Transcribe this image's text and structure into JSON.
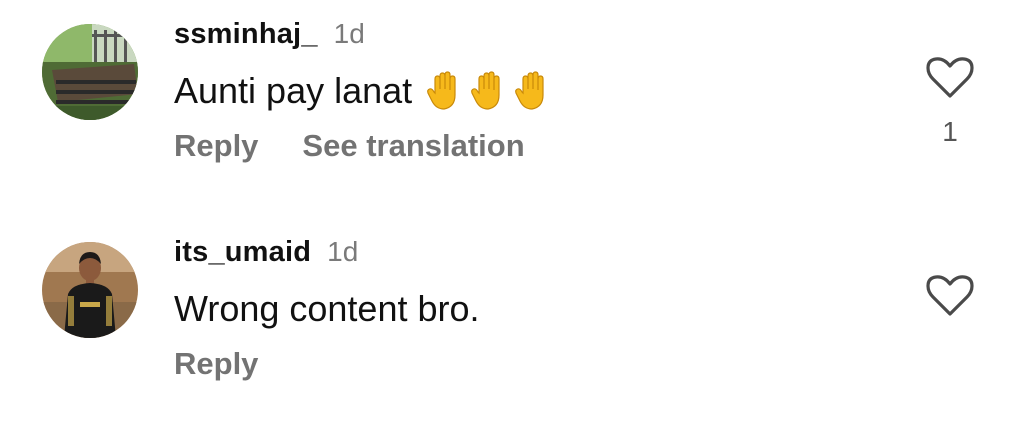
{
  "comments": [
    {
      "username": "ssminhaj_",
      "timestamp": "1d",
      "text": "Aunti pay lanat",
      "emojis": [
        "raised-hand-emoji",
        "raised-hand-emoji",
        "raised-hand-emoji"
      ],
      "actions": {
        "reply": "Reply",
        "see_translation": "See translation"
      },
      "like_icon": "heart-outline-icon",
      "like_count": "1"
    },
    {
      "username": "its_umaid",
      "timestamp": "1d",
      "text": "Wrong content bro.",
      "actions": {
        "reply": "Reply"
      },
      "like_icon": "heart-outline-icon"
    }
  ],
  "colors": {
    "username": "#111111",
    "timestamp": "#7a7a7a",
    "action": "#737373",
    "emoji": "#f6b91b"
  }
}
